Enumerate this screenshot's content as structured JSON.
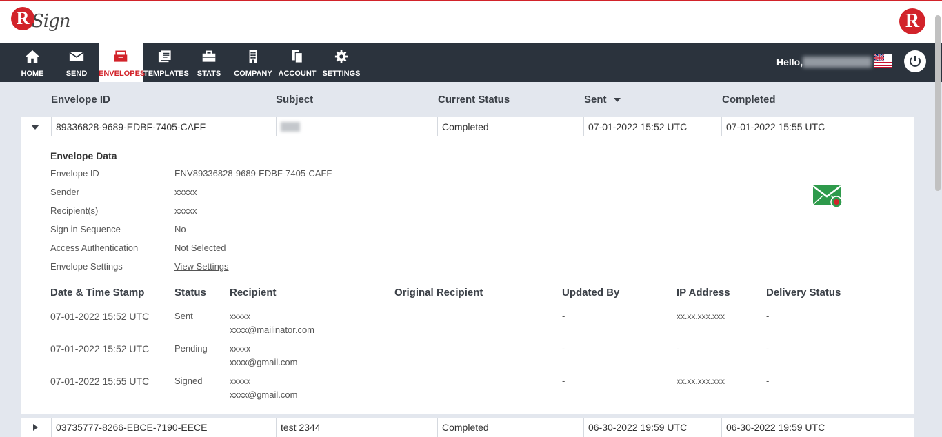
{
  "brand": {
    "logo_letter": "R",
    "logo_word": "Sign",
    "right_logo_letter": "R"
  },
  "nav": {
    "items": [
      {
        "label": "HOME",
        "icon": "home-icon"
      },
      {
        "label": "SEND",
        "icon": "envelope-icon"
      },
      {
        "label": "ENVELOPES",
        "icon": "envelopes-icon",
        "active": true
      },
      {
        "label": "TEMPLATES",
        "icon": "templates-icon"
      },
      {
        "label": "STATS",
        "icon": "briefcase-icon"
      },
      {
        "label": "COMPANY",
        "icon": "building-icon"
      },
      {
        "label": "ACCOUNT",
        "icon": "account-icon"
      },
      {
        "label": "SETTINGS",
        "icon": "gear-icon"
      }
    ],
    "greeting": "Hello,"
  },
  "table": {
    "headers": {
      "envelope_id": "Envelope ID",
      "subject": "Subject",
      "current_status": "Current Status",
      "sent": "Sent",
      "completed": "Completed"
    },
    "rows": [
      {
        "envelope_id": "89336828-9689-EDBF-7405-CAFF",
        "subject": "",
        "status": "Completed",
        "sent": "07-01-2022 15:52 UTC",
        "completed": "07-01-2022 15:55 UTC"
      },
      {
        "envelope_id": "03735777-8266-EBCE-7190-EECE",
        "subject": "test 2344",
        "status": "Completed",
        "sent": "06-30-2022 19:59 UTC",
        "completed": "06-30-2022 19:59 UTC"
      }
    ]
  },
  "detail": {
    "title": "Envelope Data",
    "fields": [
      {
        "label": "Envelope ID",
        "value": "ENV89336828-9689-EDBF-7405-CAFF"
      },
      {
        "label": "Sender",
        "value": "xxxxx"
      },
      {
        "label": "Recipient(s)",
        "value": "xxxxx"
      },
      {
        "label": "Sign in Sequence",
        "value": "No"
      },
      {
        "label": "Access Authentication",
        "value": "Not Selected"
      },
      {
        "label": "Envelope Settings",
        "value": "View Settings"
      }
    ],
    "history_headers": {
      "timestamp": "Date & Time Stamp",
      "status": "Status",
      "recipient": "Recipient",
      "original": "Original Recipient",
      "updated_by": "Updated By",
      "ip": "IP Address",
      "delivery": "Delivery Status"
    },
    "history": [
      {
        "timestamp": "07-01-2022 15:52 UTC",
        "status": "Sent",
        "name": "xxxxx",
        "email": "xxxx@mailinator.com",
        "updated_by": "-",
        "ip": "xx.xx.xxx.xxx",
        "delivery": "-"
      },
      {
        "timestamp": "07-01-2022 15:52 UTC",
        "status": "Pending",
        "name": "xxxxx",
        "email": "xxxx@gmail.com",
        "updated_by": "-",
        "ip": "-",
        "delivery": "-"
      },
      {
        "timestamp": "07-01-2022 15:55 UTC",
        "status": "Signed",
        "name": "xxxxx",
        "email": "xxxx@gmail.com",
        "updated_by": "-",
        "ip": "xx.xx.xxx.xxx",
        "delivery": "-"
      }
    ]
  },
  "colors": {
    "brand_red": "#d2232a",
    "nav_bg": "#2b333d",
    "page_bg": "#e3e7ee",
    "mail_green": "#2e9a4b"
  }
}
